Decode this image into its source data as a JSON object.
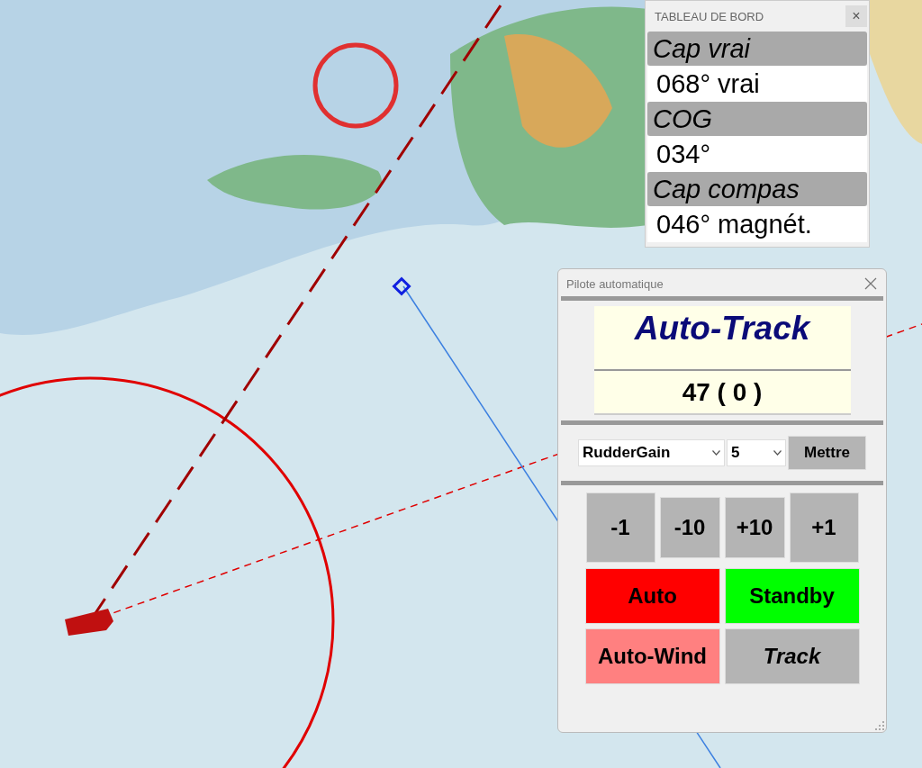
{
  "dashboard": {
    "title": "TABLEAU DE BORD",
    "close": "×",
    "items": [
      {
        "label": "Cap vrai",
        "value": "068° vrai"
      },
      {
        "label": "COG",
        "value": "034°"
      },
      {
        "label": "Cap compas",
        "value": "046° magnét."
      }
    ]
  },
  "autopilot": {
    "title": "Pilote automatique",
    "mode": "Auto-Track",
    "reading": "47 ( 0 )",
    "parameter": {
      "value": "RudderGain"
    },
    "amount": {
      "value": "5"
    },
    "apply": "Mettre",
    "steps": [
      {
        "label": "-1",
        "kind": "large"
      },
      {
        "label": "-10",
        "kind": "small"
      },
      {
        "label": "+10",
        "kind": "small"
      },
      {
        "label": "+1",
        "kind": "large"
      }
    ],
    "modes": [
      {
        "label": "Auto",
        "color": "#ff0000",
        "selected": false
      },
      {
        "label": "Standby",
        "color": "#00ff00",
        "selected": false
      },
      {
        "label": "Auto-Wind",
        "color": "#ff8080",
        "selected": false
      },
      {
        "label": "Track",
        "color": "#b4b4b4",
        "selected": true
      }
    ]
  }
}
